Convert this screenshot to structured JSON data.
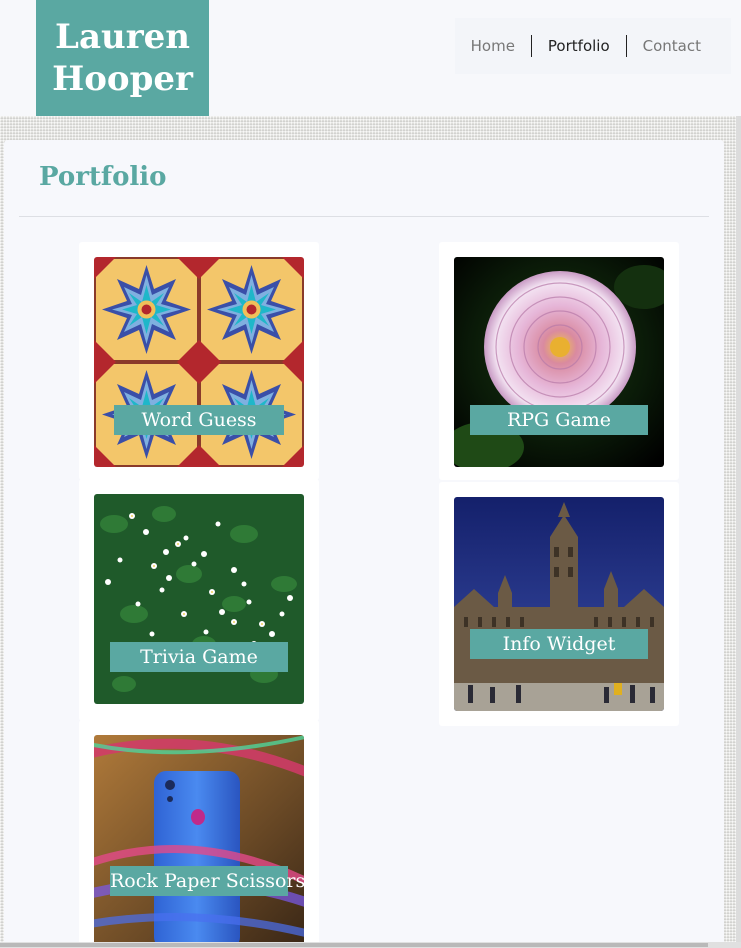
{
  "header": {
    "logo_line1": "Lauren",
    "logo_line2": "Hooper",
    "nav": [
      {
        "label": "Home",
        "active": false
      },
      {
        "label": "Portfolio",
        "active": true
      },
      {
        "label": "Contact",
        "active": false
      }
    ]
  },
  "main": {
    "title": "Portfolio",
    "projects": [
      {
        "title": "Word Guess",
        "image": "tile-pattern"
      },
      {
        "title": "RPG Game",
        "image": "dahlia-flower"
      },
      {
        "title": "Trivia Game",
        "image": "daisies-in-grass"
      },
      {
        "title": "Info Widget",
        "image": "gothic-town-hall"
      },
      {
        "title": "Rock Paper Scissors",
        "image": "phone-light-trails"
      }
    ]
  },
  "colors": {
    "accent": "#5aa8a2",
    "header_bg": "#f7f8fb",
    "panel_bg": "#f7f8fc"
  }
}
